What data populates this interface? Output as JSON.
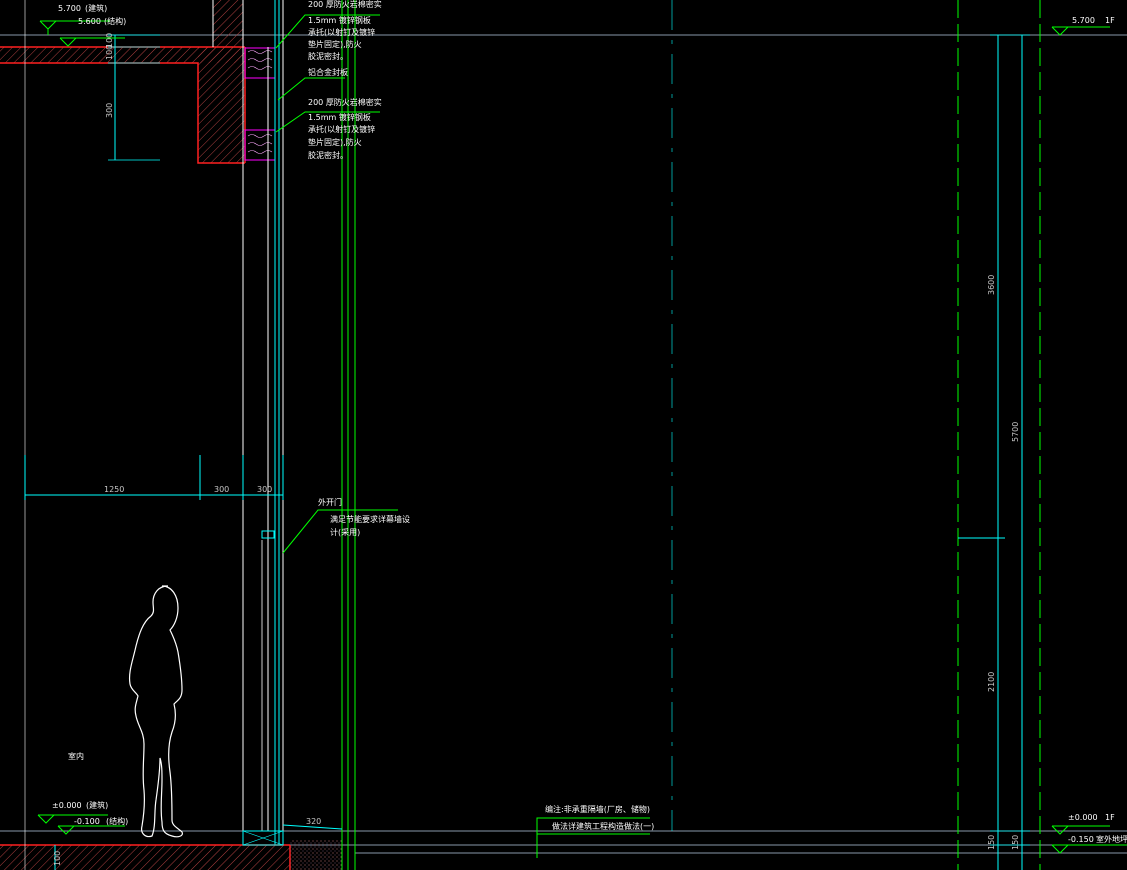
{
  "levels": {
    "top_left_arch": "5.700",
    "top_left_arch_note": "(建筑)",
    "top_left_struct": "5.600",
    "top_left_struct_note": "(结构)",
    "top_left_room": "室内",
    "bottom_left_arch": "±0.000",
    "bottom_left_arch_note": "(建筑)",
    "bottom_left_struct": "-0.100",
    "bottom_left_struct_note": "(结构)",
    "top_right": "5.700",
    "top_right_floor": "1F",
    "bottom_right": "±0.000",
    "bottom_right_floor": "1F",
    "outdoor": "-0.150",
    "outdoor_note": "室外地坪"
  },
  "dimensions": {
    "d100": "100",
    "d100b": "100",
    "d300_vert": "300",
    "d1250": "1250",
    "d300_a": "300",
    "d300_b": "300",
    "d320": "320",
    "d3600": "3600",
    "d5700": "5700",
    "d2100": "2100",
    "d150_a": "150",
    "d150_b": "150",
    "d100_bottom": "100"
  },
  "notes": {
    "note1": [
      "200 厚防火岩棉密实",
      "1.5mm  镀锌钢板",
      "承托(以射钉及镀锌",
      "垫片固定),防火",
      "胶泥密封。"
    ],
    "note2": "铝合金封板",
    "note3": [
      "200 厚防火岩棉密实",
      "1.5mm  镀锌钢板",
      "承托(以射钉及镀锌",
      "垫片固定),防火",
      "胶泥密封。"
    ],
    "door": [
      "外开门",
      "满足节能要求详幕墙设",
      "计(采用)"
    ],
    "indoor_label": "室内",
    "footer1": "编注:非承重隔墙(厂房、储物)",
    "footer2": "做法详建筑工程构造做法(一)"
  },
  "colors": {
    "background": "#000000",
    "outline": "#ffffff",
    "dim_cyan": "#00ffff",
    "guide_green": "#00ff00",
    "hatch_red": "#ff2020",
    "magenta": "#ff00ff",
    "blue_line": "#4488ff"
  }
}
